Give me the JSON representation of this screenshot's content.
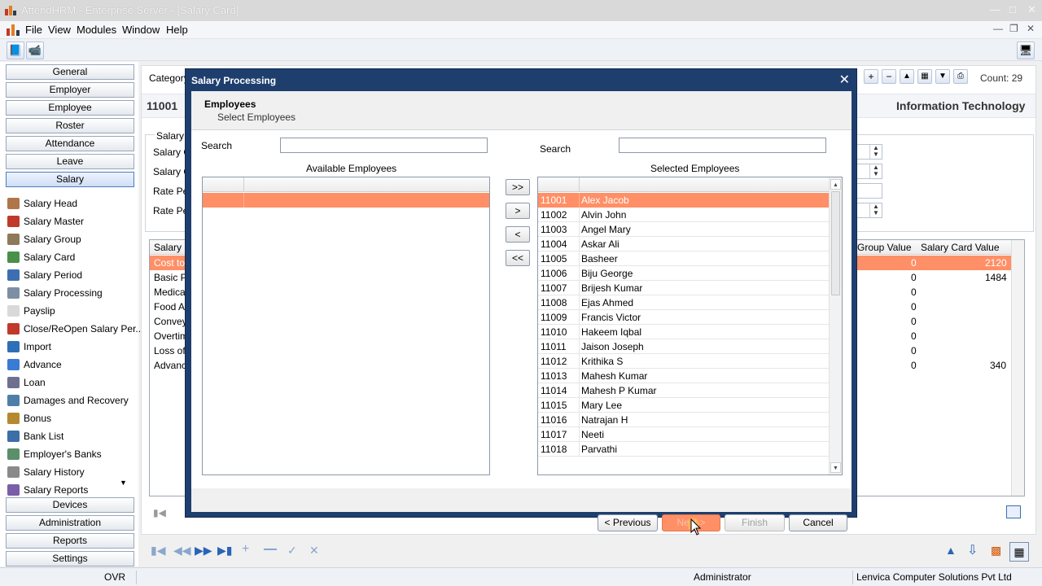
{
  "window": {
    "title": "AttendHRM - Enterprise Server - [Salary Card]"
  },
  "menu": [
    "File",
    "View",
    "Modules",
    "Window",
    "Help"
  ],
  "nav": {
    "top_buttons": [
      "General",
      "Employer",
      "Employee",
      "Roster",
      "Attendance",
      "Leave",
      "Salary"
    ],
    "items": [
      "Salary Head",
      "Salary Master",
      "Salary Group",
      "Salary Card",
      "Salary Period",
      "Salary Processing",
      "Payslip",
      "Close/ReOpen Salary Per...",
      "Import",
      "Advance",
      "Loan",
      "Damages and Recovery",
      "Bonus",
      "Bank List",
      "Employer's Banks",
      "Salary History",
      "Salary Reports"
    ],
    "bottom_buttons": [
      "Devices",
      "Administration",
      "Reports",
      "Settings"
    ]
  },
  "background": {
    "category_label": "Category",
    "emp_code": "11001",
    "department": "Information Technology",
    "count": "Count: 29",
    "group_label": "Salary",
    "field_labels": [
      "Salary C",
      "Salary G",
      "Rate Pe",
      "Rate Pe"
    ],
    "table_header_left": "Salary H",
    "table_header_group": "Group Value",
    "table_header_card": "Salary Card Value",
    "rows": [
      {
        "name": "Cost to",
        "group": "0",
        "card": "2120"
      },
      {
        "name": "Basic P",
        "group": "0",
        "card": "1484"
      },
      {
        "name": "Medical",
        "group": "0",
        "card": ""
      },
      {
        "name": "Food All",
        "group": "0",
        "card": ""
      },
      {
        "name": "Convey",
        "group": "0",
        "card": ""
      },
      {
        "name": "Overtim",
        "group": "0",
        "card": ""
      },
      {
        "name": "Loss of",
        "group": "0",
        "card": ""
      },
      {
        "name": "Advanc",
        "group": "0",
        "card": "340"
      }
    ]
  },
  "status": {
    "mode": "OVR",
    "user": "Administrator",
    "company": "Lenvica Computer Solutions Pvt Ltd"
  },
  "dialog": {
    "title": "Salary Processing",
    "heading": "Employees",
    "subheading": "Select Employees",
    "search_label_left": "Search",
    "search_label_right": "Search",
    "search_value_left": "",
    "search_value_right": "",
    "available_title": "Available Employees",
    "selected_title": "Selected Employees",
    "move_buttons": [
      ">>",
      ">",
      "<",
      "<<"
    ],
    "selected_employees": [
      {
        "code": "11001",
        "name": "Alex Jacob"
      },
      {
        "code": "11002",
        "name": "Alvin John"
      },
      {
        "code": "11003",
        "name": "Angel Mary"
      },
      {
        "code": "11004",
        "name": "Askar Ali"
      },
      {
        "code": "11005",
        "name": "Basheer"
      },
      {
        "code": "11006",
        "name": "Biju George"
      },
      {
        "code": "11007",
        "name": "Brijesh Kumar"
      },
      {
        "code": "11008",
        "name": "Ejas Ahmed"
      },
      {
        "code": "11009",
        "name": "Francis Victor"
      },
      {
        "code": "11010",
        "name": "Hakeem Iqbal"
      },
      {
        "code": "11011",
        "name": "Jaison Joseph"
      },
      {
        "code": "11012",
        "name": "Krithika S"
      },
      {
        "code": "11013",
        "name": "Mahesh Kumar"
      },
      {
        "code": "11014",
        "name": "Mahesh P Kumar"
      },
      {
        "code": "11015",
        "name": "Mary Lee"
      },
      {
        "code": "11016",
        "name": "Natrajan H"
      },
      {
        "code": "11017",
        "name": "Neeti"
      },
      {
        "code": "11018",
        "name": "Parvathi"
      }
    ],
    "buttons": {
      "previous": "< Previous",
      "next": "Next >",
      "finish": "Finish",
      "cancel": "Cancel"
    }
  },
  "colors": {
    "selection": "#ff8f66",
    "dialog_frame": "#1e3f6e"
  }
}
